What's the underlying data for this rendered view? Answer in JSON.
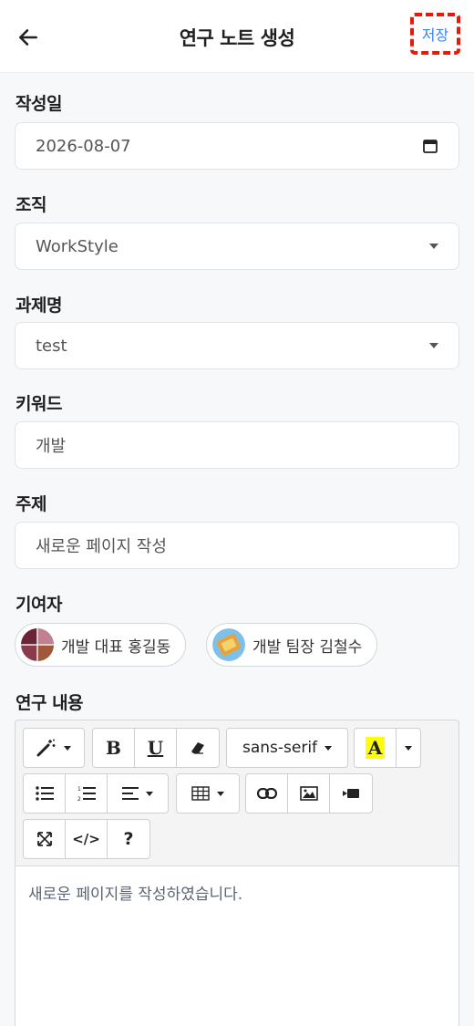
{
  "header": {
    "title": "연구 노트 생성",
    "save_label": "저장",
    "back_icon": "arrow-left-icon"
  },
  "form": {
    "date": {
      "label": "작성일",
      "value": "2026-08-07",
      "icon": "calendar-icon"
    },
    "org": {
      "label": "조직",
      "value": "WorkStyle"
    },
    "project": {
      "label": "과제명",
      "value": "test"
    },
    "keyword": {
      "label": "키워드",
      "value": "개발"
    },
    "subject": {
      "label": "주제",
      "value": "새로운 페이지 작성"
    },
    "contributors": {
      "label": "기여자",
      "items": [
        {
          "name": "개발 대표  홍길동"
        },
        {
          "name": "개발 팀장  김철수"
        }
      ]
    },
    "content": {
      "label": "연구 내용",
      "toolbar": {
        "font_name": "sans-serif",
        "bold": "B",
        "underline": "U",
        "highlight": "A",
        "code": "</>",
        "help": "?"
      },
      "body": "새로운 페이지를 작성하였습니다."
    }
  },
  "colors": {
    "save_text": "#3b82f6",
    "save_highlight_border": "#e8180c",
    "highlight_fill": "#ffff00"
  }
}
